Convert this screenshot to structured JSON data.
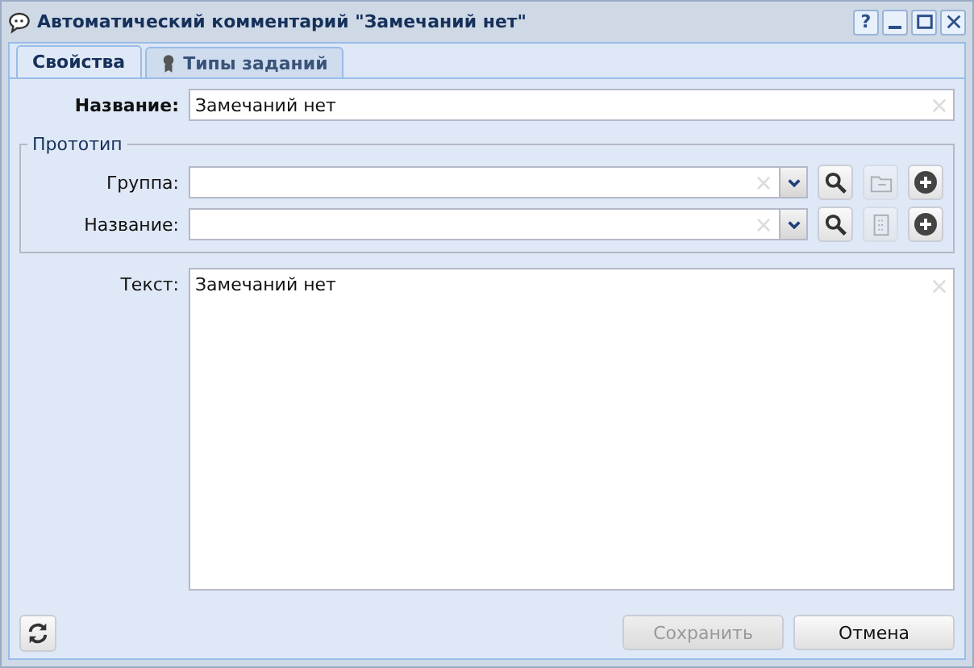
{
  "window": {
    "title": "Автоматический комментарий \"Замечаний нет\"",
    "controls": [
      {
        "kind": "help",
        "label": "?"
      },
      {
        "kind": "minimize"
      },
      {
        "kind": "maximize"
      },
      {
        "kind": "close"
      }
    ]
  },
  "tabs": [
    {
      "label": "Свойства",
      "selected": true
    },
    {
      "label": "Типы заданий",
      "selected": false
    }
  ],
  "name_field": {
    "label": "Название:",
    "value": "Замечаний нет"
  },
  "prototype": {
    "legend": "Прототип",
    "rows": [
      {
        "label": "Группа:",
        "tools": [
          {
            "kind": "search",
            "disabled": false
          },
          {
            "kind": "folder",
            "disabled": true
          },
          {
            "kind": "add",
            "disabled": false
          }
        ]
      },
      {
        "label": "Название:",
        "tools": [
          {
            "kind": "search",
            "disabled": false
          },
          {
            "kind": "document",
            "disabled": true
          },
          {
            "kind": "add",
            "disabled": false
          }
        ]
      }
    ]
  },
  "text_field": {
    "label": "Текст:",
    "value": "Замечаний нет"
  },
  "buttons": [
    {
      "label": "Сохранить",
      "disabled": true
    },
    {
      "label": "Отмена",
      "disabled": false
    }
  ]
}
